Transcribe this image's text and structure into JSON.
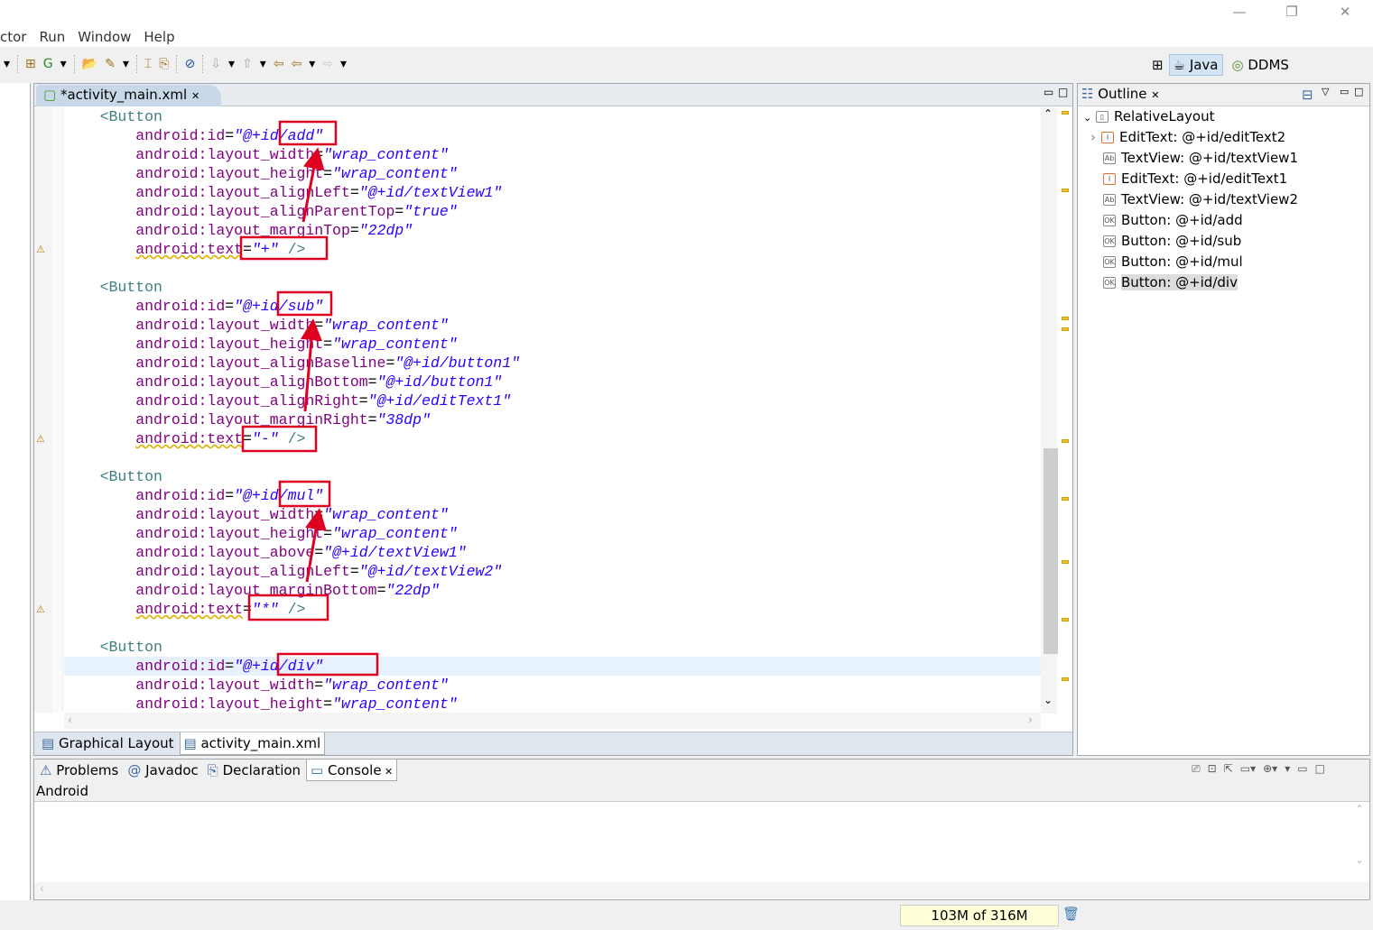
{
  "window": {
    "minimize": "—",
    "restore": "❐",
    "close": "✕"
  },
  "menu": [
    "ctor",
    "Run",
    "Window",
    "Help"
  ],
  "perspectives": {
    "java": "Java",
    "ddms": "DDMS"
  },
  "editor": {
    "tab_label": "*activity_main.xml",
    "bottom_tabs": [
      "Graphical Layout",
      "activity_main.xml"
    ],
    "lines": [
      {
        "tag": "<Button"
      },
      {
        "attr": "android:id",
        "val": "\"@+id/add\""
      },
      {
        "attr": "android:layout_width",
        "val": "\"wrap_content\""
      },
      {
        "attr": "android:layout_height",
        "val": "\"wrap_content\""
      },
      {
        "attr": "android:layout_alignLeft",
        "val": "\"@+id/textView1\""
      },
      {
        "attr": "android:layout_alignParentTop",
        "val": "\"true\""
      },
      {
        "attr": "android:layout_marginTop",
        "val": "\"22dp\""
      },
      {
        "attr": "android:text",
        "val": "\"+\"",
        "end": " />",
        "warn": true
      },
      {},
      {
        "tag": "<Button"
      },
      {
        "attr": "android:id",
        "val": "\"@+id/sub\""
      },
      {
        "attr": "android:layout_width",
        "val": "\"wrap_content\""
      },
      {
        "attr": "android:layout_height",
        "val": "\"wrap_content\""
      },
      {
        "attr": "android:layout_alignBaseline",
        "val": "\"@+id/button1\""
      },
      {
        "attr": "android:layout_alignBottom",
        "val": "\"@+id/button1\""
      },
      {
        "attr": "android:layout_alignRight",
        "val": "\"@+id/editText1\""
      },
      {
        "attr": "android:layout_marginRight",
        "val": "\"38dp\""
      },
      {
        "attr": "android:text",
        "val": "\"-\"",
        "end": " />",
        "warn": true
      },
      {},
      {
        "tag": "<Button"
      },
      {
        "attr": "android:id",
        "val": "\"@+id/mul\""
      },
      {
        "attr": "android:layout_width",
        "val": "\"wrap_content\""
      },
      {
        "attr": "android:layout_height",
        "val": "\"wrap_content\""
      },
      {
        "attr": "android:layout_above",
        "val": "\"@+id/textView1\""
      },
      {
        "attr": "android:layout_alignLeft",
        "val": "\"@+id/textView2\""
      },
      {
        "attr": "android:layout_marginBottom",
        "val": "\"22dp\""
      },
      {
        "attr": "android:text",
        "val": "\"*\"",
        "end": " />",
        "warn": true
      },
      {},
      {
        "tag": "<Button"
      },
      {
        "attr": "android:id",
        "val": "\"@+id/div\"",
        "current": true
      },
      {
        "attr": "android:layout_width",
        "val": "\"wrap_content\""
      },
      {
        "attr": "android:layout_height",
        "val": "\"wrap_content\""
      }
    ]
  },
  "outline": {
    "title": "Outline",
    "root": "RelativeLayout",
    "items": [
      {
        "icon": "edittext-icon",
        "label": "EditText: @+id/editText2",
        "expandable": true
      },
      {
        "icon": "textview-icon",
        "label": "TextView: @+id/textView1"
      },
      {
        "icon": "edittext-icon",
        "label": "EditText: @+id/editText1"
      },
      {
        "icon": "textview-icon",
        "label": "TextView: @+id/textView2"
      },
      {
        "icon": "button-icon",
        "label": "Button: @+id/add"
      },
      {
        "icon": "button-icon",
        "label": "Button: @+id/sub"
      },
      {
        "icon": "button-icon",
        "label": "Button: @+id/mul"
      },
      {
        "icon": "button-icon",
        "label": "Button: @+id/div",
        "selected": true
      }
    ]
  },
  "console": {
    "tabs": [
      "Problems",
      "Javadoc",
      "Declaration",
      "Console"
    ],
    "active": "Console",
    "title": "Android"
  },
  "status": {
    "memory": "103M of 316M"
  },
  "annotation_color": "#e00020"
}
